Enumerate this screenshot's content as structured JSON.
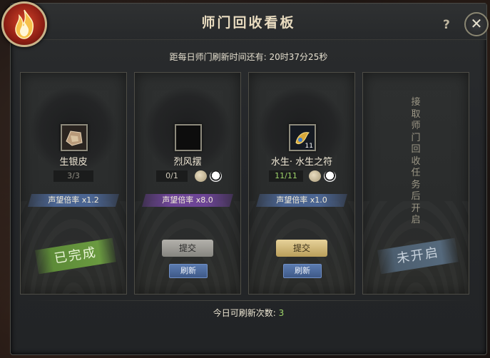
{
  "window": {
    "title": "师门回收看板",
    "help_label": "?",
    "close_label": "✕",
    "emblem_icon": "flame-emblem-icon"
  },
  "timer_text": "距每日师门刷新时间还有: 20时37分25秒",
  "cards": [
    {
      "item_name": "生银皮",
      "item_icon": "silver-hide-icon",
      "count": "3/3",
      "ribbon": "声望倍率 x1.2",
      "ribbon_color": "#4b6592",
      "stamp": "已完成"
    },
    {
      "item_name": "烈风摆",
      "item_icon": "empty-slot-icon",
      "count": "0/1",
      "ribbon": "声望倍率 x8.0",
      "ribbon_color": "#6d4596",
      "submit_label": "提交",
      "refresh_label": "刷新"
    },
    {
      "item_name": "水生· 水生之符",
      "item_icon": "water-charm-icon",
      "item_stack": "11",
      "count": "11/11",
      "ribbon": "声望倍率 x1.0",
      "ribbon_color": "#4b6592",
      "submit_label": "提交",
      "refresh_label": "刷新"
    },
    {
      "vertical_text": "接取师门回收任务后开启",
      "stamp": "未开启"
    }
  ],
  "footer": {
    "label": "今日可刷新次数: ",
    "count": "3"
  }
}
